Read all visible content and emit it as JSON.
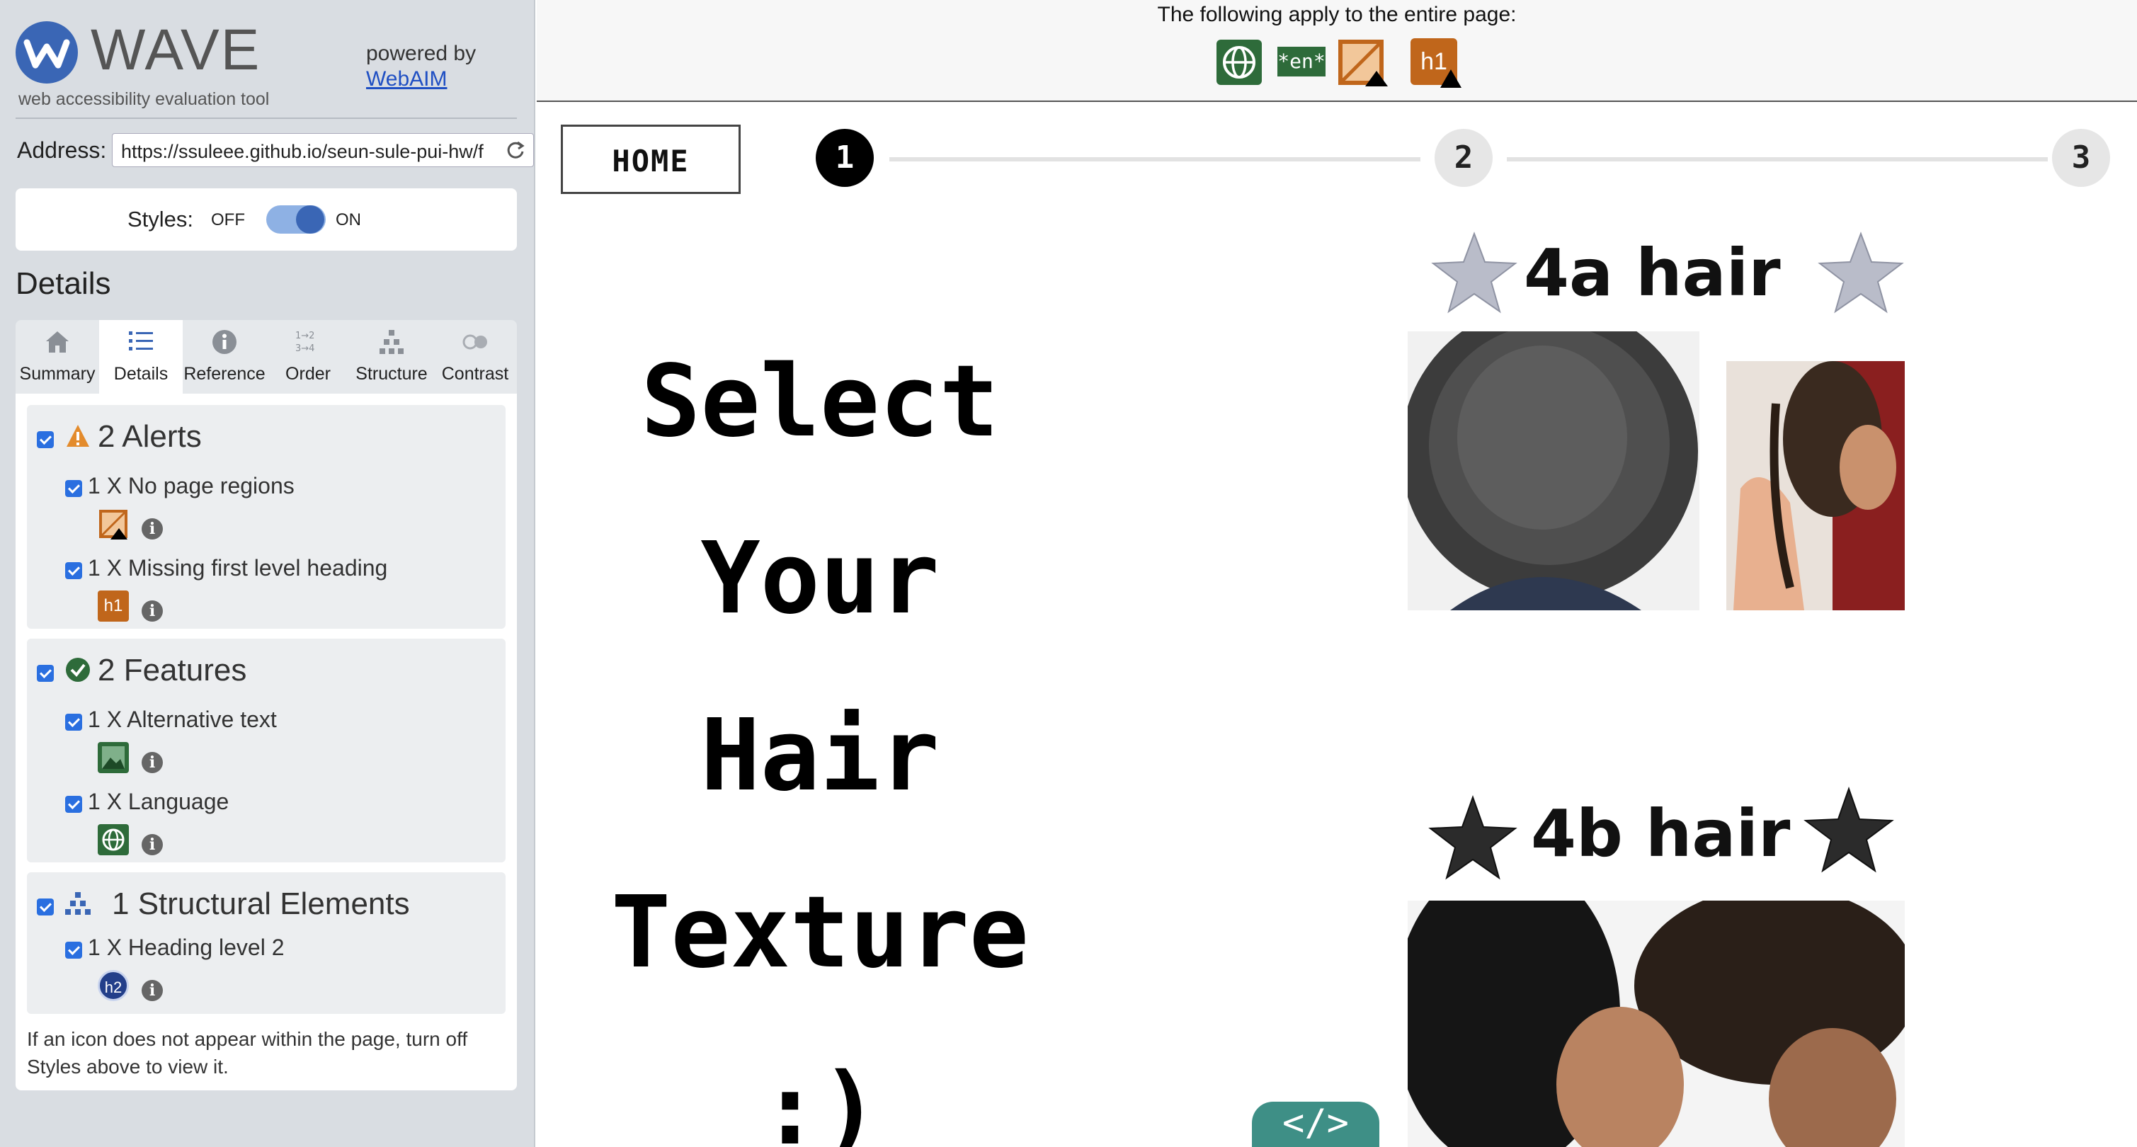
{
  "brand": {
    "name": "WAVE",
    "tagline": "web accessibility evaluation tool",
    "powered_by": "powered by",
    "webaim_link": "WebAIM"
  },
  "address": {
    "label": "Address:",
    "value": "https://ssuleee.github.io/seun-sule-pui-hw/f"
  },
  "styles": {
    "label": "Styles:",
    "off": "OFF",
    "on": "ON",
    "state": "on"
  },
  "details_heading": "Details",
  "tabs": [
    {
      "label": "Summary",
      "icon": "home-icon"
    },
    {
      "label": "Details",
      "icon": "list-icon",
      "active": true
    },
    {
      "label": "Reference",
      "icon": "info-icon"
    },
    {
      "label": "Order",
      "icon": "order-icon"
    },
    {
      "label": "Structure",
      "icon": "structure-icon"
    },
    {
      "label": "Contrast",
      "icon": "contrast-icon"
    }
  ],
  "groups": {
    "alerts": {
      "title": "2 Alerts",
      "items": [
        {
          "text": "1 X No page regions",
          "icon": "no-regions-icon"
        },
        {
          "text": "1 X Missing first level heading",
          "icon": "h1-missing-icon",
          "icon_text": "h1"
        }
      ]
    },
    "features": {
      "title": "2 Features",
      "items": [
        {
          "text": "1 X Alternative text",
          "icon": "alt-text-icon"
        },
        {
          "text": "1 X Language",
          "icon": "language-icon"
        }
      ]
    },
    "structural": {
      "title": "1 Structural Elements",
      "items": [
        {
          "text": "1 X Heading level 2",
          "icon": "h2-icon",
          "icon_text": "h2"
        }
      ]
    }
  },
  "note": "If an icon does not appear within the page, turn off Styles above to view it.",
  "topbar": {
    "apply_text": "The following apply to the entire page:",
    "en_badge": "*en*",
    "h1_badge": "h1"
  },
  "page": {
    "home": "HOME",
    "steps": [
      "1",
      "2",
      "3"
    ],
    "active_step": 1,
    "headline_lines": [
      "Select",
      "Your",
      "Hair",
      "Texture",
      ":)"
    ],
    "hair_4a": "4a hair",
    "hair_4b": "4b hair",
    "code_button": "</>"
  },
  "colors": {
    "wave_blue": "#3a66b5",
    "alert_orange": "#c0661b",
    "feature_green": "#2e6b3a",
    "checkbox_blue": "#2a6fe0",
    "code_teal": "#3e8f86"
  }
}
